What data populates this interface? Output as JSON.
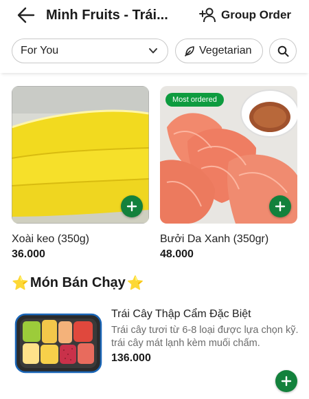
{
  "header": {
    "title": "Minh Fruits - Trái...",
    "group_order_label": "Group Order"
  },
  "filters": {
    "category_selected": "For You",
    "vegetarian_label": "Vegetarian"
  },
  "products": [
    {
      "name": "Xoài keo (350g)",
      "price": "36.000",
      "badge": ""
    },
    {
      "name": "Bưởi Da Xanh (350gr)",
      "price": "48.000",
      "badge": "Most ordered"
    }
  ],
  "section": {
    "title": "Món Bán Chạy",
    "star_left": "⭐",
    "star_right": "⭐"
  },
  "list_items": [
    {
      "name": "Trái Cây Thập Cẩm Đặc Biệt",
      "description": "Trái cây tươi từ 6-8 loại được lựa chọn kỹ. trái cây mát lạnh kèm muối chấm.",
      "price": "136.000"
    }
  ],
  "colors": {
    "accent_green": "#13813c",
    "badge_green": "#0e9b3f",
    "star_yellow": "#f5b301"
  },
  "icons": [
    "arrow-left-icon",
    "group-users-icon",
    "chevron-down-icon",
    "leaf-icon",
    "search-icon",
    "plus-icon"
  ]
}
